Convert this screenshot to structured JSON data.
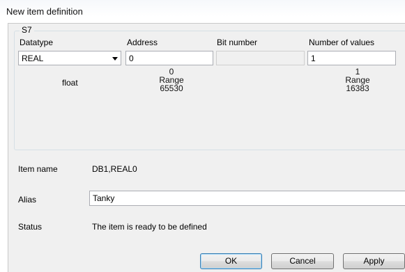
{
  "window": {
    "title": "New item definition"
  },
  "group": {
    "title": "S7"
  },
  "datatype": {
    "label": "Datatype",
    "selected": "REAL",
    "type_hint": "float"
  },
  "address": {
    "label": "Address",
    "value": "0",
    "min": "0",
    "range_label": "Range",
    "max": "65530"
  },
  "bit_number": {
    "label": "Bit number",
    "value": ""
  },
  "number_of_values": {
    "label": "Number of values",
    "value": "1",
    "min": "1",
    "range_label": "Range",
    "max": "16383"
  },
  "item_name": {
    "label": "Item name",
    "value": "DB1,REAL0"
  },
  "alias": {
    "label": "Alias",
    "value": "Tanky"
  },
  "status": {
    "label": "Status",
    "value": "The item is ready to be defined"
  },
  "buttons": {
    "ok": "OK",
    "cancel": "Cancel",
    "apply": "Apply"
  }
}
